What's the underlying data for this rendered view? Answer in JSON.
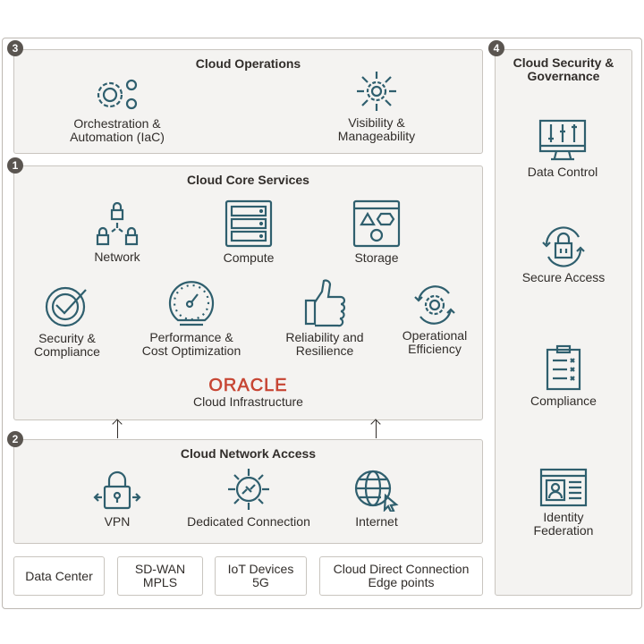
{
  "colors": {
    "icon": "#2f5f6e",
    "panel": "#f4f3f1",
    "badge": "#5a5550",
    "oracle_red": "#c74634"
  },
  "operations": {
    "badge": "3",
    "title": "Cloud Operations",
    "items": [
      {
        "label": "Orchestration & Automation (IaC)",
        "line1": "Orchestration &",
        "line2": "Automation (IaC)",
        "icon": "gears-icon"
      },
      {
        "label": "Visibility & Manageability",
        "line1": "Visibility &",
        "line2": "Manageability",
        "icon": "gear-arrows-icon"
      }
    ]
  },
  "core": {
    "badge": "1",
    "title": "Cloud Core Services",
    "items": [
      {
        "line1": "Network",
        "icon": "network-locks-icon"
      },
      {
        "line1": "Compute",
        "icon": "server-icon"
      },
      {
        "line1": "Storage",
        "icon": "storage-shapes-icon"
      },
      {
        "line1": "Security &",
        "line2": "Compliance",
        "icon": "check-shield-icon"
      },
      {
        "line1": "Performance &",
        "line2": "Cost Optimization",
        "icon": "speedometer-icon"
      },
      {
        "line1": "Reliability and",
        "line2": "Resilience",
        "icon": "thumbs-up-icon"
      },
      {
        "line1": "Operational",
        "line2": "Efficiency",
        "icon": "gear-cycle-icon"
      }
    ],
    "logo": "ORACLE",
    "logo_sub": "Cloud Infrastructure"
  },
  "network": {
    "badge": "2",
    "title": "Cloud Network Access",
    "items": [
      {
        "line1": "VPN",
        "icon": "vpn-lock-icon"
      },
      {
        "line1": "Dedicated Connection",
        "icon": "plug-connection-icon"
      },
      {
        "line1": "Internet",
        "icon": "globe-cursor-icon"
      }
    ]
  },
  "sources": [
    {
      "line1": "Data Center"
    },
    {
      "line1": "SD-WAN",
      "line2": "MPLS"
    },
    {
      "line1": "IoT Devices",
      "line2": "5G"
    },
    {
      "line1": "Cloud Direct Connection",
      "line2": "Edge points"
    }
  ],
  "governance": {
    "badge": "4",
    "title1": "Cloud Security &",
    "title2": "Governance",
    "items": [
      {
        "line1": "Data Control",
        "icon": "monitor-sliders-icon"
      },
      {
        "line1": "Secure Access",
        "icon": "lock-cycle-icon"
      },
      {
        "line1": "Compliance",
        "icon": "clipboard-checklist-icon"
      },
      {
        "line1": "Identity",
        "line2": "Federation",
        "icon": "id-card-icon"
      }
    ]
  }
}
